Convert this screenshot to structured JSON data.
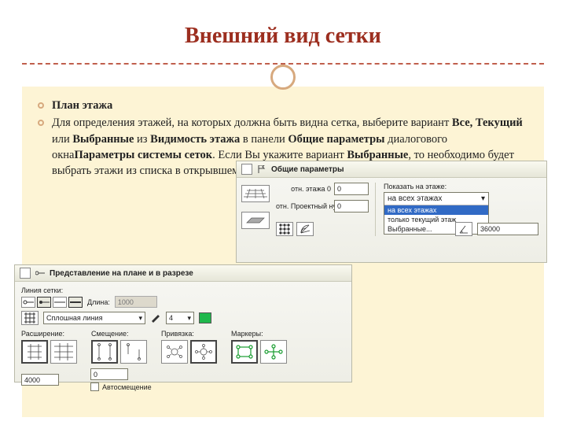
{
  "title": "Внешний вид сетки",
  "bullets": {
    "heading": "План этажа",
    "paragraph_html": "Для определения этажей, на которых должна быть видна сетка, выберите вариант <b>Все, Текущий</b> или <b>Выбранные</b> из <b>Видимость этажа</b> в панели <b>Общие параметры</b> диалогового окна<b>Параметры системы сеток</b>. Если Вы укажите вариант <b>Выбранные</b>, то необходимо будет выбрать этажи из списка в открывшемся диалоговом окне."
  },
  "panel1": {
    "title": "Общие параметры",
    "ref_story_label": "отн. этажа 0",
    "ref_story_value": "0",
    "ref_zero_label": "отн. Проектный нуль",
    "ref_zero_value": "0",
    "show_label": "Показать на этаже:",
    "dropdown_selected": "на всех этажах",
    "dropdown_options": [
      "на всех этажах",
      "только текущий этаж",
      "Выбранные..."
    ],
    "dropdown_highlight": "на всех этажах",
    "angle_value": "36000"
  },
  "panel2": {
    "title": "Представление на плане и в разрезе",
    "line_label": "Линия сетки:",
    "length_label": "Длина:",
    "length_value": "1000",
    "line_type": "Сплошная линия",
    "pen_value": "4",
    "group_extension": "Расширение:",
    "group_offset": "Смещение:",
    "group_snap": "Привязка:",
    "group_markers": "Маркеры:",
    "extension_value": "4000",
    "offset_value": "0",
    "auto_offset_label": "Автосмещение"
  }
}
